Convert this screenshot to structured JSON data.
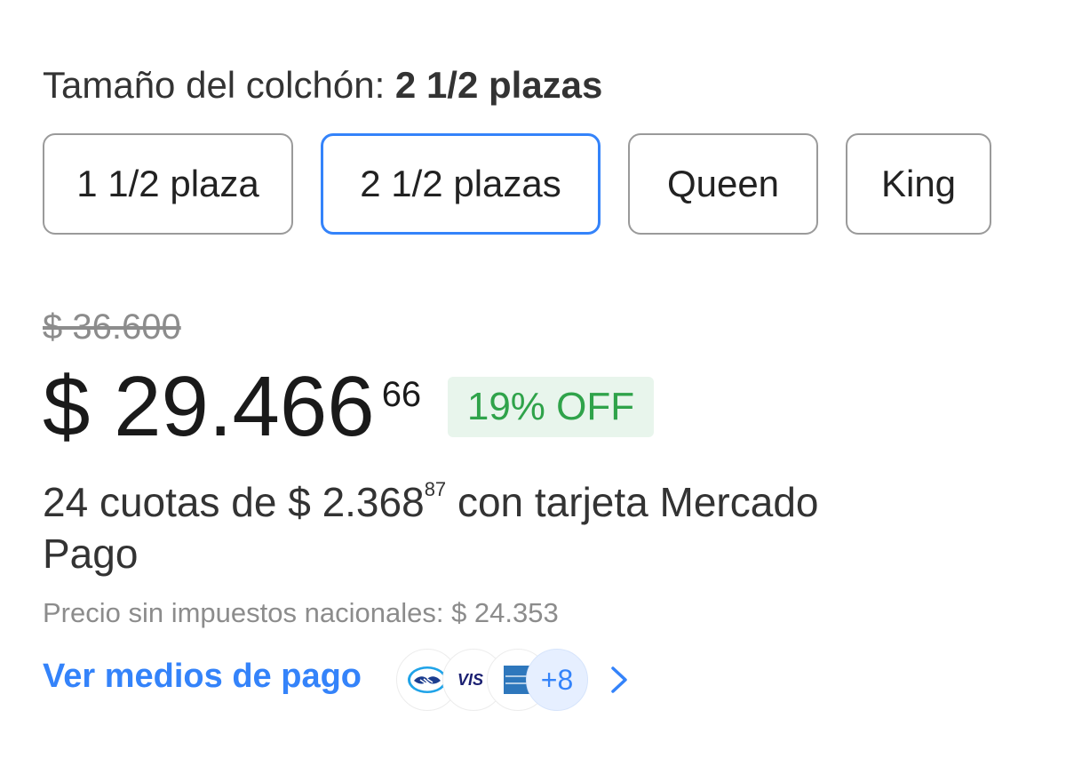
{
  "variant": {
    "label": "Tamaño del colchón:",
    "selected_value": "2 1/2 plazas",
    "options": [
      "1 1/2 plaza",
      "2 1/2 plazas",
      "Queen",
      "King"
    ],
    "selected_index": 1
  },
  "price": {
    "original": "$ 36.600",
    "current_amount": "$ 29.466",
    "current_cents": "66",
    "discount": "19% OFF"
  },
  "installments": {
    "prefix": "24 cuotas de ",
    "amount": "$ 2.368",
    "cents": "87",
    "suffix": " con tarjeta Mercado Pago"
  },
  "tax_note": "Precio sin impuestos nacionales: $ 24.353",
  "payment": {
    "link_label": "Ver medios de pago",
    "methods": [
      "mercado-pago-icon",
      "visa-icon",
      "amex-icon"
    ],
    "more_count": "+8"
  },
  "colors": {
    "accent": "#3483fa",
    "discount_text": "#2fa34a",
    "discount_bg": "#e8f5ec",
    "muted_text": "#8c8c8c"
  }
}
